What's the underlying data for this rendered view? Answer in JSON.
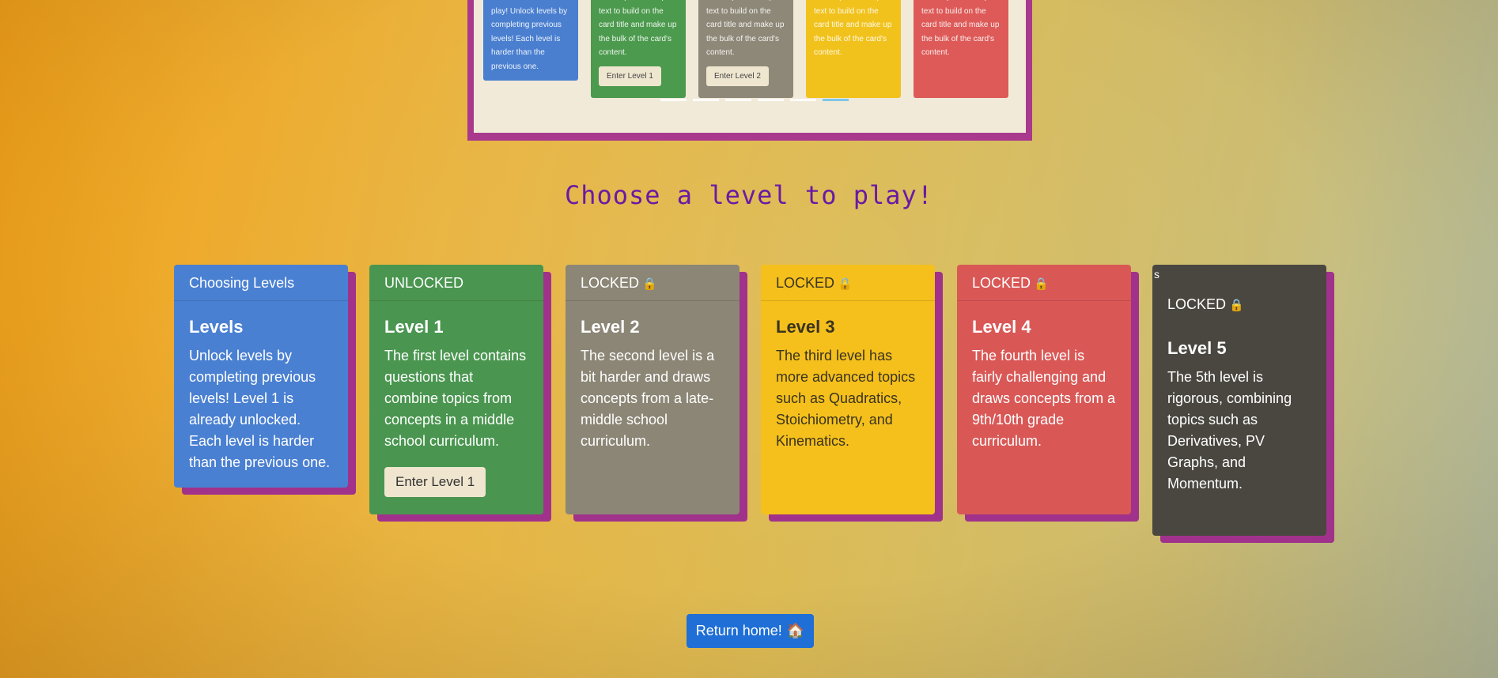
{
  "preview": {
    "cards": [
      {
        "text": "Choose a level to play! Unlock levels by completing previous levels! Each level is harder than the previous one.",
        "button": "",
        "color": "#4a7fd0"
      },
      {
        "text": "Some quick example text to build on the card title and make up the bulk of the card's content.",
        "button": "Enter Level 1",
        "color": "#4c9a4e"
      },
      {
        "text": "Some quick example text to build on the card title and make up the bulk of the card's content.",
        "button": "Enter Level 2",
        "color": "#8e8878"
      },
      {
        "text": "Some quick example text to build on the card title and make up the bulk of the card's content.",
        "button": "",
        "color": "#f1c21c"
      },
      {
        "text": "Some quick example text to build on the card title and make up the bulk of the card's content.",
        "button": "",
        "color": "#dd5a58"
      }
    ],
    "active_indicator": 6,
    "indicator_count": 6
  },
  "heading": "Choose a level to play!",
  "cards": [
    {
      "header": "Choosing Levels",
      "locked": false,
      "title": "Levels",
      "text": "Unlock levels by completing previous levels! Level 1 is already unlocked. Each level is harder than the previous one.",
      "button": "",
      "color": "#4a80d2"
    },
    {
      "header": "UNLOCKED",
      "locked": false,
      "title": "Level 1",
      "text": "The first level contains questions that combine topics from concepts in a middle school curriculum.",
      "button": "Enter Level 1",
      "color": "#4a9650"
    },
    {
      "header": "LOCKED",
      "locked": true,
      "title": "Level 2",
      "text": "The second level is a bit harder and draws concepts from a late-middle school curriculum.",
      "button": "",
      "color": "#8c8676"
    },
    {
      "header": "LOCKED",
      "locked": true,
      "title": "Level 3",
      "text": "The third level has more advanced topics such as Quadratics, Stoichiometry, and Kinematics.",
      "button": "",
      "color": "#f5c01c"
    },
    {
      "header": "LOCKED",
      "locked": true,
      "title": "Level 4",
      "text": "The fourth level is fairly challenging and draws concepts from a 9th/10th grade curriculum.",
      "button": "",
      "color": "#d95856"
    },
    {
      "header": "LOCKED",
      "locked": true,
      "title": "Level 5",
      "text": "The 5th level is rigorous, combining topics such as Derivatives, PV Graphs, and Momentum.",
      "button": "",
      "color": "#4a4740",
      "corner_mark": "s"
    }
  ],
  "home_button": {
    "label": "Return home!",
    "icon": "home-icon"
  }
}
